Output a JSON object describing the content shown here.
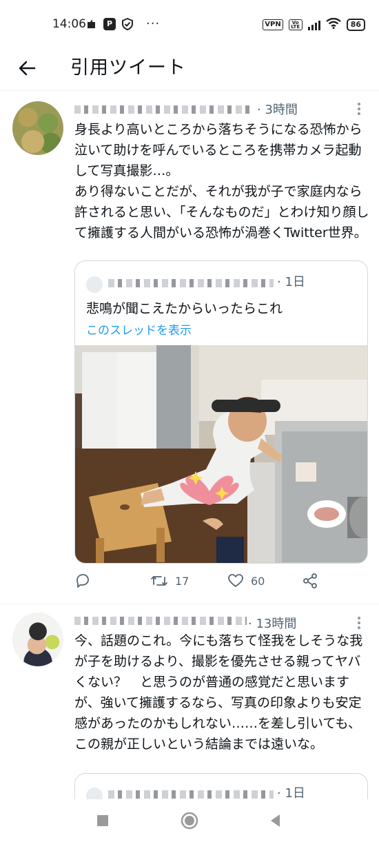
{
  "status_bar": {
    "time": "14:06",
    "left_icons": [
      "notification-icon",
      "app-p-icon",
      "shield-check-icon"
    ],
    "more": "···",
    "vpn_label": "VPN",
    "volte_label": "Vo LTE",
    "battery": "86"
  },
  "header": {
    "back_icon": "arrow-left-icon",
    "title": "引用ツイート"
  },
  "tweets": [
    {
      "time": "· 3時間",
      "text": "身長より高いところから落ちそうになる恐怖から泣いて助けを呼んでいるところを携帯カメラ起動して写真撮影…。\nあり得ないことだが、それが我が子で家庭内なら許されると思い、「そんなものだ」とわけ知り顔して擁護する人間がいる恐怖が渦巻くTwitter世界。",
      "quote": {
        "time": "· 1日",
        "text": "悲鳴が聞こえたからいったらこれ",
        "show_thread": "このスレッドを表示"
      },
      "actions": {
        "reply_count": "",
        "retweet_count": "17",
        "like_count": "60"
      }
    },
    {
      "time": "· 13時間",
      "text": "今、話題のこれ。今にも落ちて怪我をしそうな我が子を助けるより、撮影を優先させる親ってヤバくない？　と思うのが普通の感覚だと思いますが、強いて擁護するなら、写真の印象よりも安定感があったのかもしれない……を差し引いても、この親が正しいという結論までは遠いな。",
      "quote": {
        "time": "· 1日"
      }
    }
  ],
  "colors": {
    "link": "#1d9bf0",
    "text": "#0f1419",
    "secondary": "#536471",
    "border": "#cfd9de"
  }
}
